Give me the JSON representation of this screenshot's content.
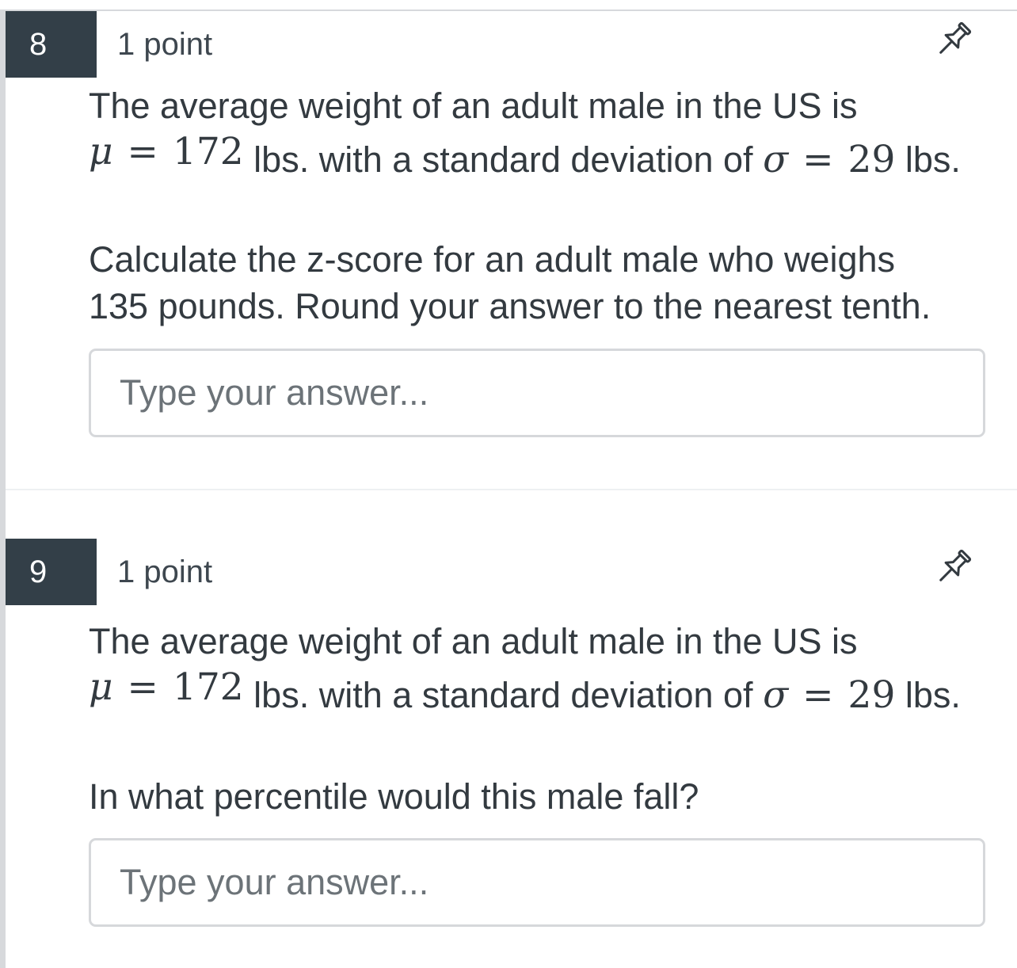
{
  "questions": [
    {
      "number": "8",
      "points": "1 point",
      "pin_icon": "pin-icon",
      "intro": "The average weight of an adult male in the US is",
      "mu_symbol": "μ",
      "equals": "=",
      "mu_value": "172",
      "middle_text": "lbs. with a standard deviation of",
      "sigma_symbol": "σ",
      "sigma_value": "29",
      "units_end": "lbs.",
      "prompt_line1": "Calculate the z-score for an adult male who weighs",
      "prompt_line2": "135 pounds.  Round your answer to the nearest tenth.",
      "answer_placeholder": "Type your answer..."
    },
    {
      "number": "9",
      "points": "1 point",
      "pin_icon": "pin-icon",
      "intro": "The average weight of an adult male in the US is",
      "mu_symbol": "μ",
      "equals": "=",
      "mu_value": "172",
      "middle_text": "lbs. with a standard deviation of",
      "sigma_symbol": "σ",
      "sigma_value": "29",
      "units_end": "lbs.",
      "prompt_line1": "In what percentile would this male fall?",
      "answer_placeholder": "Type your answer..."
    }
  ],
  "colors": {
    "number_badge_bg": "#333f48",
    "text": "#333a40",
    "input_border": "#d6d8db"
  }
}
